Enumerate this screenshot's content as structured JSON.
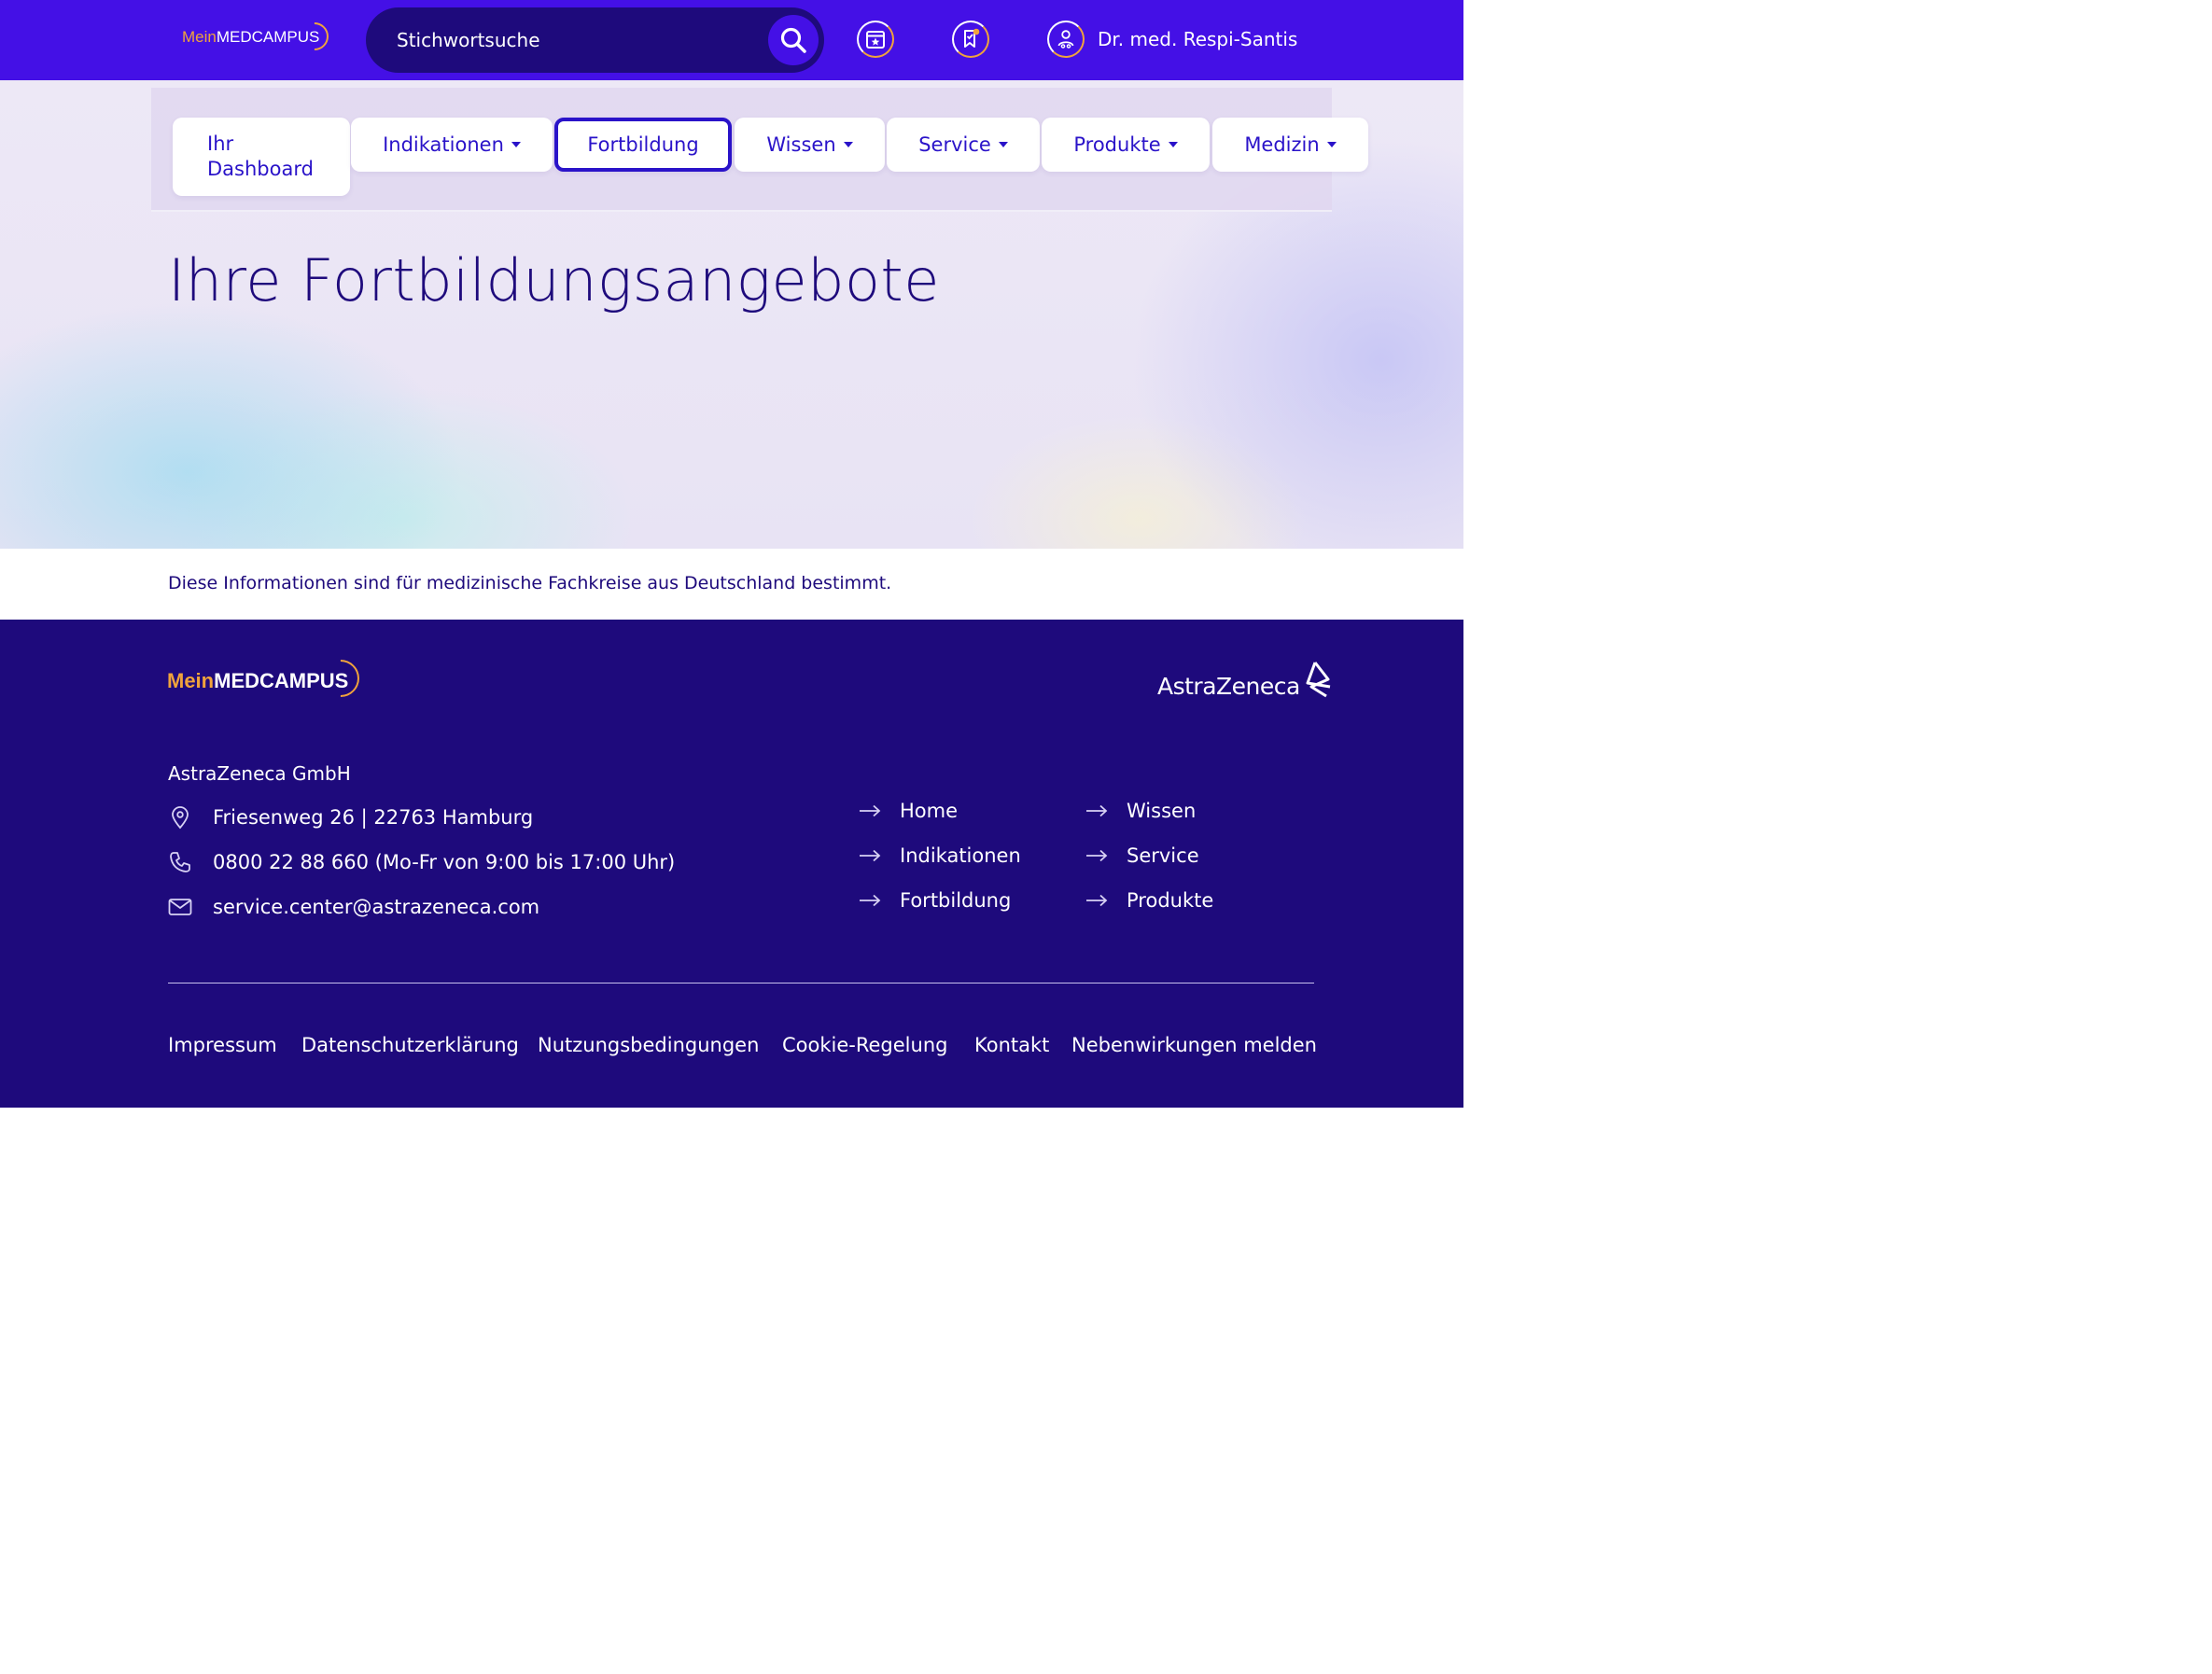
{
  "header": {
    "logo": {
      "mein": "Mein",
      "medcampus": "MEDCAMPUS"
    },
    "search": {
      "placeholder": "Stichwortsuche"
    },
    "icons": [
      "calendar-star-icon",
      "bookmark-notification-icon",
      "user-profile-icon"
    ],
    "user_name": "Dr. med. Respi-Santis"
  },
  "nav": {
    "items": [
      {
        "label": "Ihr Dashboard"
      },
      {
        "label": "Indikationen",
        "dropdown": true
      },
      {
        "label": "Fortbildung",
        "active": true
      },
      {
        "label": "Wissen",
        "dropdown": true
      },
      {
        "label": "Service",
        "dropdown": true
      },
      {
        "label": "Produkte",
        "dropdown": true
      },
      {
        "label": "Medizin",
        "dropdown": true
      }
    ]
  },
  "main": {
    "title": "Ihre Fortbildungsangebote",
    "disclaimer": "Diese Informationen sind für medizinische Fachkreise aus Deutschland bestimmt."
  },
  "footer": {
    "logo": {
      "mein": "Mein",
      "medcampus": "MEDCAMPUS"
    },
    "partner_logo": "AstraZeneca",
    "company": "AstraZeneca GmbH",
    "address": "Friesenweg 26 | 22763 Hamburg",
    "phone": "0800 22 88 660 (Mo-Fr von 9:00 bis 17:00 Uhr)",
    "email": "service.center@astrazeneca.com",
    "links_col1": [
      "Home",
      "Indikationen",
      "Fortbildung"
    ],
    "links_col2": [
      "Wissen",
      "Service",
      "Produkte"
    ],
    "legal_links": [
      "Impressum",
      "Datenschutzerklärung",
      "Nutzungsbedingungen",
      "Cookie-Regelung",
      "Kontakt",
      "Nebenwirkungen melden"
    ]
  },
  "colors": {
    "header_bg": "#4410e6",
    "search_bg": "#1e0a7c",
    "footer_bg": "#1e0a7c",
    "accent_orange": "#f0a33c",
    "nav_text": "#2a13c9"
  }
}
